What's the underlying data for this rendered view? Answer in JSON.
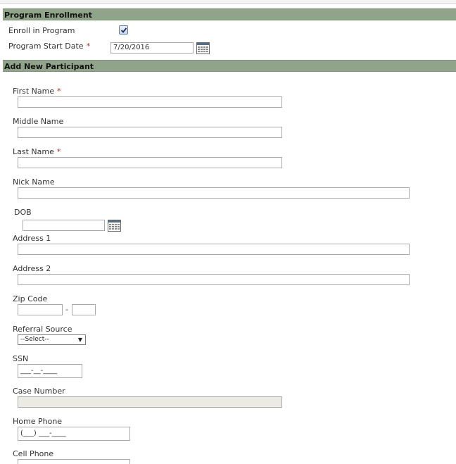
{
  "enrollment": {
    "title": "Program Enrollment",
    "enroll_label": "Enroll in Program",
    "enroll_checked": true,
    "start_date_label": "Program Start Date",
    "start_date_value": "7/20/2016"
  },
  "participant": {
    "title": "Add New Participant",
    "first_name_label": "First Name",
    "middle_name_label": "Middle Name",
    "last_name_label": "Last Name",
    "nick_name_label": "Nick Name",
    "dob_label": "DOB",
    "address1_label": "Address 1",
    "address2_label": "Address 2",
    "zip_label": "Zip Code",
    "zip_separator": "-",
    "referral_label": "Referral Source",
    "referral_selected": "--Select--",
    "ssn_label": "SSN",
    "ssn_mask": "___-__-____",
    "case_number_label": "Case Number",
    "home_phone_label": "Home Phone",
    "home_phone_mask": "(___) ___-____",
    "cell_phone_label": "Cell Phone"
  },
  "required_marker": "*",
  "icons": {
    "calendar": "calendar-icon",
    "checkbox": "checkmark-icon",
    "dropdown": "chevron-down-icon"
  },
  "colors": {
    "section_bar": "#8fa488",
    "required": "#cc2222",
    "disabled_field": "#ebebe4"
  }
}
